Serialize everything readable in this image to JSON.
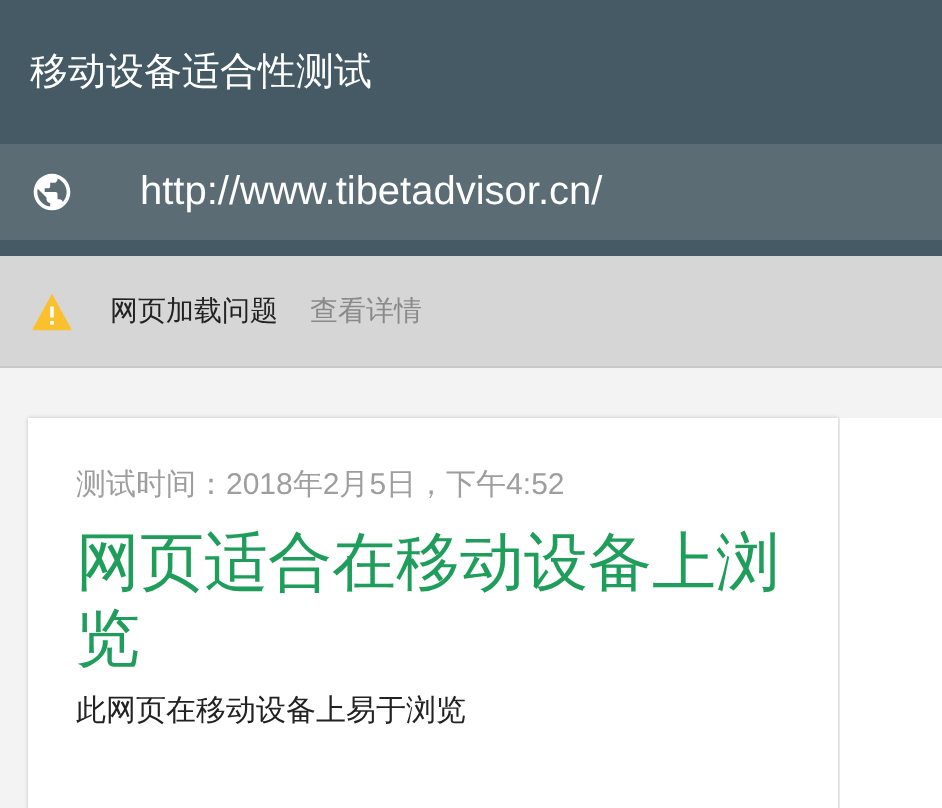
{
  "header": {
    "title": "移动设备适合性测试"
  },
  "url_bar": {
    "url": "http://www.tibetadvisor.cn/"
  },
  "warning_bar": {
    "message": "网页加载问题",
    "link": "查看详情"
  },
  "result_card": {
    "test_time": "测试时间：2018年2月5日，下午4:52",
    "headline": "网页适合在移动设备上浏览",
    "description": "此网页在移动设备上易于浏览"
  }
}
